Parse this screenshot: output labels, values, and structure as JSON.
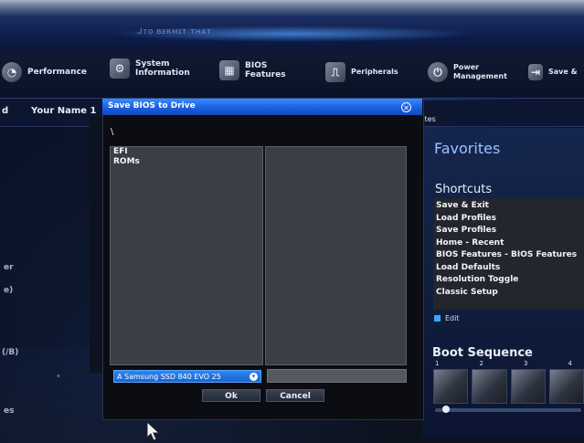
{
  "top_menu": {
    "items": [
      {
        "label": "Performance",
        "icon": "performance-icon"
      },
      {
        "label_line1": "System",
        "label_line2": "Information",
        "icon": "gear-icon"
      },
      {
        "label_line1": "BIOS",
        "label_line2": "Features",
        "icon": "bios-features-icon"
      },
      {
        "label": "Peripherals",
        "icon": "peripherals-icon"
      },
      {
        "label_line1": "Power",
        "label_line2": "Management",
        "icon": "power-icon"
      },
      {
        "label": "Save &",
        "icon": "save-exit-icon"
      }
    ]
  },
  "sub_bar": {
    "user": "Your Name 1",
    "left_fragment": "d",
    "right_fragment": "rites"
  },
  "background_title": "ᒍᴛᴏ ʙᴇʀᴍɪᴛ ᴛʜᴀᴛ",
  "left_ghost_labels": [
    "er",
    "e)",
    "(/B)",
    "es"
  ],
  "dialog": {
    "title": "Save BIOS to Drive",
    "path": "\\",
    "directories": [
      "EFI",
      "ROMs"
    ],
    "drive": "A Samsung SSD 840 EVO 25",
    "filename": "",
    "ok_label": "Ok",
    "cancel_label": "Cancel"
  },
  "favorites": {
    "title": "Favorites",
    "shortcuts_title": "Shortcuts",
    "shortcuts": [
      "Save & Exit",
      "Load Profiles",
      "Save Profiles",
      "Home - Recent",
      "BIOS Features - BIOS Features",
      "Load Defaults",
      "Resolution Toggle",
      "Classic Setup"
    ],
    "edit_label": "Edit",
    "boot_sequence_title": "Boot Sequence",
    "boot_slots": [
      "1",
      "2",
      "3",
      "4"
    ]
  },
  "colors": {
    "dialog_title_bar": "#1a5fe0",
    "accent_blue": "#3aa6ff",
    "favorites_title": "#9dc2ff"
  }
}
